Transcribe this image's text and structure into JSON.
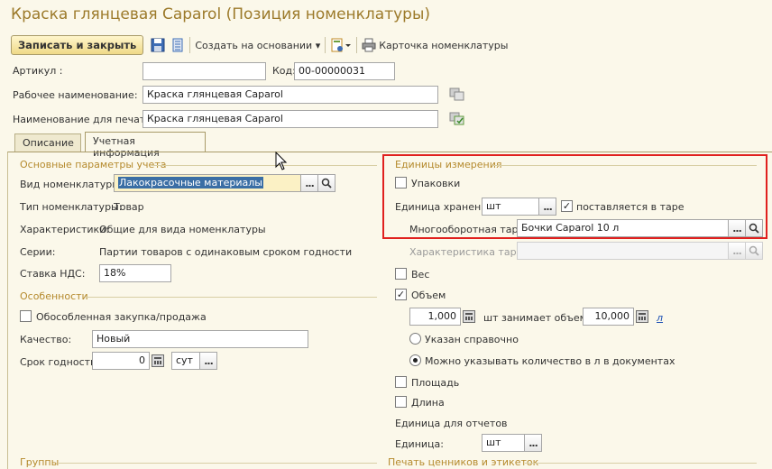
{
  "window": {
    "title": "Краска глянцевая Caparol (Позиция номенклатуры)"
  },
  "toolbar": {
    "save_close": "Записать и закрыть",
    "create_based": "Создать на основании",
    "nomenclature_card": "Карточка номенклатуры",
    "dropdown_glyph": "▾"
  },
  "header_fields": {
    "article_label": "Артикул :",
    "article_value": "",
    "code_label": "Код:",
    "code_value": "00-00000031",
    "work_name_label": "Рабочее наименование:",
    "work_name_value": "Краска глянцевая Caparol",
    "print_name_label": "Наименование для печати:",
    "print_name_value": "Краска глянцевая Caparol"
  },
  "tabs": [
    {
      "label": "Описание",
      "active": false
    },
    {
      "label": "Учетная информация",
      "active": true
    }
  ],
  "left": {
    "basic_group": "Основные параметры учета",
    "kind_label": "Вид номенклатуры:",
    "kind_value": "Лакокрасочные материалы",
    "type_label": "Тип номенклатуры:",
    "type_value": "Товар",
    "char_label": "Характеристики:",
    "char_value": "Общие для вида номенклатуры",
    "series_label": "Серии:",
    "series_value": "Партии товаров с одинаковым сроком годности",
    "vat_label": "Ставка НДС:",
    "vat_value": "18%",
    "features_group": "Особенности",
    "separate_purchase_label": "Обособленная закупка/продажа",
    "separate_purchase_checked": false,
    "quality_label": "Качество:",
    "quality_value": "Новый",
    "shelf_life_label": "Срок годности:",
    "shelf_life_value": "0",
    "shelf_life_unit": "сут",
    "groups_group": "Группы"
  },
  "right": {
    "units_group": "Единицы измерения",
    "packaging_label": "Упаковки",
    "packaging_checked": false,
    "storage_unit_label": "Единица хранения:",
    "storage_unit_value": "шт",
    "in_container_label": "поставляется в таре",
    "in_container_checked": true,
    "returnable_label": "Многооборотная тара:",
    "returnable_value": "Бочки Caparol 10 л",
    "container_char_label": "Характеристика тары:",
    "container_char_value": "",
    "weight_label": "Вес",
    "weight_checked": false,
    "volume_label": "Объем",
    "volume_checked": true,
    "volume_qty": "1,000",
    "volume_text": "шт занимает объем",
    "volume_amount": "10,000",
    "volume_unit_link": "л",
    "radio_reference": "Указан справочно",
    "radio_reference_on": false,
    "radio_docs": "Можно указывать количество в л в документах",
    "radio_docs_on": true,
    "area_label": "Площадь",
    "area_checked": false,
    "length_label": "Длина",
    "length_checked": false,
    "report_unit_title": "Единица для отчетов",
    "unit_label": "Единица:",
    "unit_value": "шт",
    "print_tags_group": "Печать ценников и этикеток"
  },
  "icons": {
    "dots": "...",
    "check": "✓"
  },
  "colors": {
    "accent": "#9c7a2a",
    "group_title": "#b58a2d",
    "highlight_border": "#e0201e",
    "selection": "#3a6ea5"
  }
}
